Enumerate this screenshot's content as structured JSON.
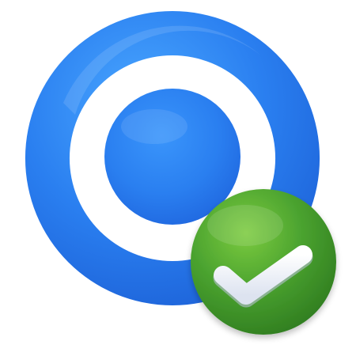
{
  "icon": {
    "name": "target-check-icon",
    "parts": [
      {
        "name": "target-ring-icon",
        "color": "#2a7ff0"
      },
      {
        "name": "target-center-dot-icon",
        "color": "#2a7ff0"
      },
      {
        "name": "check-badge-icon",
        "color": "#4aa22f"
      },
      {
        "name": "checkmark-icon",
        "color": "#f2f4fa"
      }
    ]
  },
  "colors": {
    "background": "#ffffff",
    "ring_light": "#4aa7ff",
    "ring_mid": "#2a7ff0",
    "ring_dark": "#1d62d8",
    "badge_light": "#7ccb3f",
    "badge_mid": "#4aa22f",
    "badge_dark": "#2e7a1f",
    "check_light": "#ffffff",
    "check_dark": "#dde3f0"
  }
}
